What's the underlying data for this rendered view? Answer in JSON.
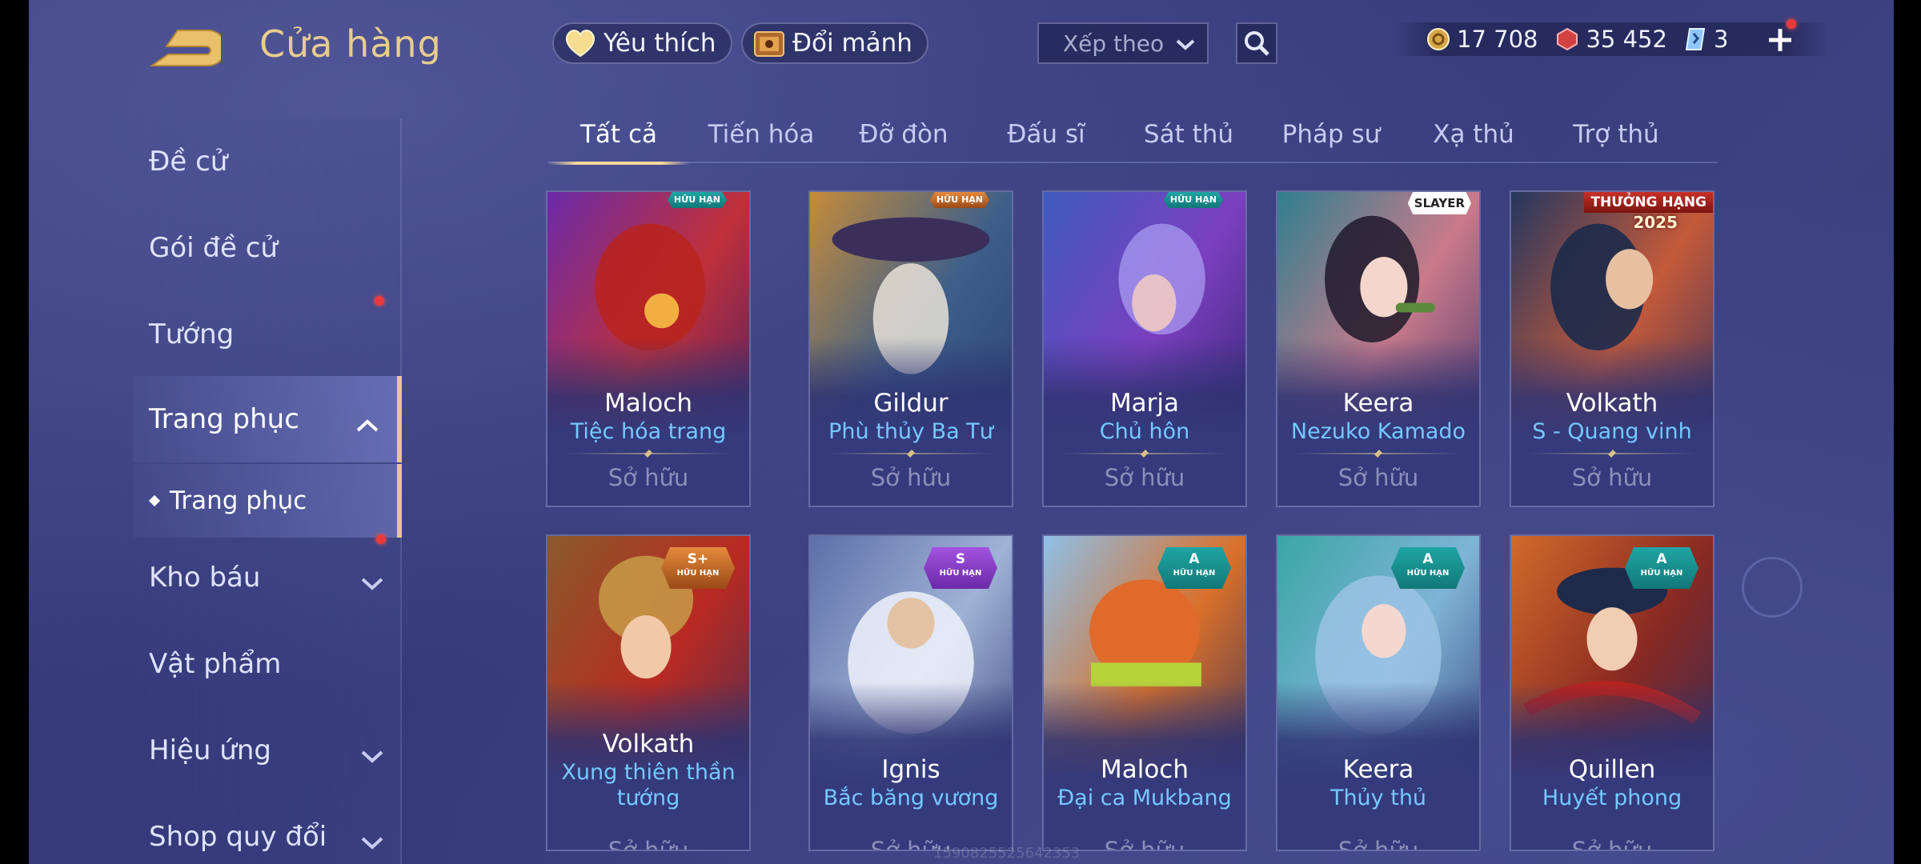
{
  "header": {
    "title": "Cửa hàng",
    "favorites_label": "Yêu thích",
    "exchange_label": "Đổi mảnh",
    "sort_label": "Xếp theo",
    "currencies": [
      {
        "icon": "gold-coin-icon",
        "value": "17 708"
      },
      {
        "icon": "red-voucher-icon",
        "value": "35 452"
      },
      {
        "icon": "blue-ticket-icon",
        "value": "3"
      }
    ]
  },
  "sidebar": {
    "items": [
      {
        "label": "Đề cử"
      },
      {
        "label": "Gói đề cử"
      },
      {
        "label": "Tướng"
      },
      {
        "label": "Trang phục"
      },
      {
        "label": "Trang phục"
      },
      {
        "label": "Kho báu"
      },
      {
        "label": "Vật phẩm"
      },
      {
        "label": "Hiệu ứng"
      },
      {
        "label": "Shop quy đổi"
      }
    ]
  },
  "tabs": [
    "Tất cả",
    "Tiến hóa",
    "Đỡ đòn",
    "Đấu sĩ",
    "Sát thủ",
    "Pháp sư",
    "Xạ thủ",
    "Trợ thủ"
  ],
  "cards": [
    {
      "hero": "Maloch",
      "skin": "Tiệc hóa trang",
      "status": "Sở hữu",
      "badge": "HỮU HẠN",
      "grade": ""
    },
    {
      "hero": "Gildur",
      "skin": "Phù thủy Ba Tư",
      "status": "Sở hữu",
      "badge": "HỮU HẠN",
      "grade": ""
    },
    {
      "hero": "Marja",
      "skin": "Chủ hôn",
      "status": "Sở hữu",
      "badge": "HỮU HẠN",
      "grade": ""
    },
    {
      "hero": "Keera",
      "skin": "Nezuko Kamado",
      "status": "Sở hữu",
      "badge": "SLAYER",
      "grade": ""
    },
    {
      "hero": "Volkath",
      "skin": "S - Quang vinh",
      "status": "Sở hữu",
      "badge": "THƯỞNG HẠNG",
      "grade": "2025"
    },
    {
      "hero": "Volkath",
      "skin": "Xung thiên thần tướng",
      "status": "Sở hữu",
      "badge": "HỮU HẠN",
      "grade": "S+"
    },
    {
      "hero": "Ignis",
      "skin": "Bắc băng vương",
      "status": "Sở hữu",
      "badge": "HỮU HẠN",
      "grade": "S"
    },
    {
      "hero": "Maloch",
      "skin": "Đại ca Mukbang",
      "status": "Sở hữu",
      "badge": "HỮU HẠN",
      "grade": "A"
    },
    {
      "hero": "Keera",
      "skin": "Thủy thủ",
      "status": "Sở hữu",
      "badge": "HỮU HẠN",
      "grade": "A"
    },
    {
      "hero": "Quillen",
      "skin": "Huyết phong",
      "status": "Sở hữu",
      "badge": "HỮU HẠN",
      "grade": "A"
    }
  ],
  "watermark": "1590825525642353"
}
